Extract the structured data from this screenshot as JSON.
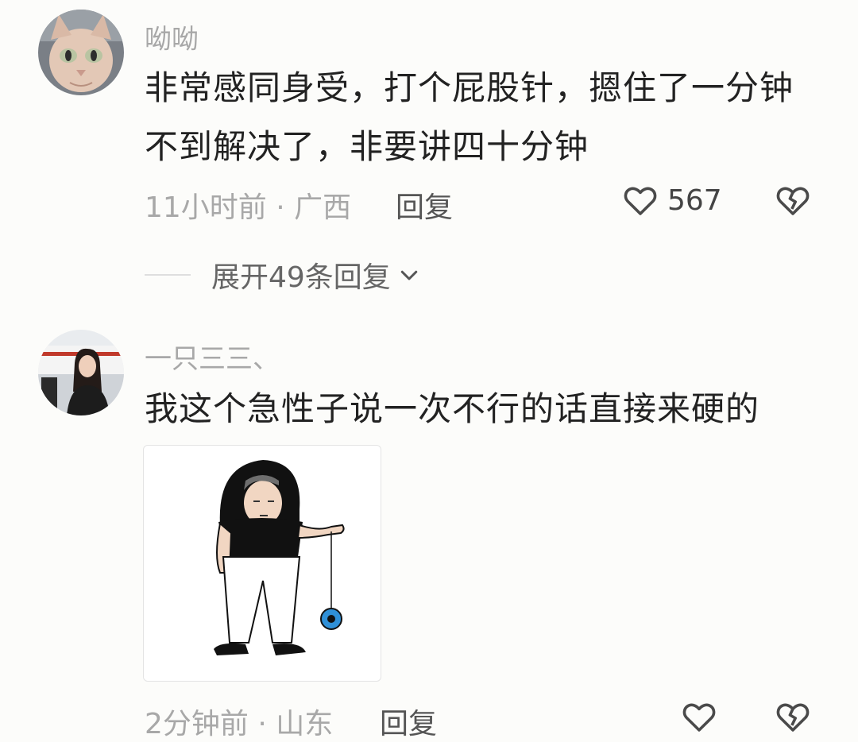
{
  "comments": [
    {
      "username": "呦呦",
      "text": "非常感同身受，打个屁股针，摁住了一分钟不到解决了，非要讲四十分钟",
      "time": "11小时前",
      "location": "广西",
      "reply_label": "回复",
      "likes": "567",
      "expand_label": "展开49条回复"
    },
    {
      "username": "一只三三、",
      "text": "我这个急性子说一次不行的话直接来硬的",
      "time": "2分钟前",
      "location": "山东",
      "reply_label": "回复",
      "likes": ""
    }
  ],
  "separator": " · ",
  "icons": {
    "like": "heart-outline-icon",
    "dislike": "broken-heart-icon",
    "expand": "chevron-down-icon"
  },
  "colors": {
    "muted": "#a8a8a8",
    "text": "#222222",
    "background": "#fcfcfa"
  }
}
